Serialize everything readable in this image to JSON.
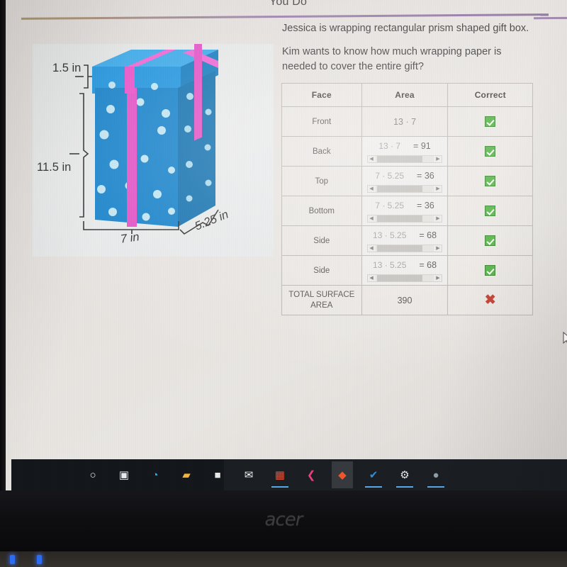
{
  "lesson": {
    "section_title": "You Do",
    "paragraph1": "Jessica is wrapping rectangular prism shaped gift box.",
    "paragraph2": "Kim wants to know how much wrapping paper is needed to cover the entire gift?"
  },
  "figure": {
    "height_label": "11.5 in",
    "lid_label": "1.5 in",
    "width_label": "7 in",
    "depth_label": "5.25 in",
    "box_color": "#1380c9",
    "lid_color": "#1f93dd",
    "ribbon_color": "#e14fc4",
    "dot_color": "#bfe4f2"
  },
  "table": {
    "headers": [
      "Face",
      "Area",
      "Correct"
    ],
    "rows": [
      {
        "face": "Front",
        "expr": "13 · 7",
        "result": "",
        "has_scrollbar": false,
        "correct": "check"
      },
      {
        "face": "Back",
        "expr": "13 · 7",
        "result": "= 91",
        "has_scrollbar": true,
        "correct": "check"
      },
      {
        "face": "Top",
        "expr": "7 · 5.25",
        "result": "= 36",
        "has_scrollbar": true,
        "correct": "check"
      },
      {
        "face": "Bottom",
        "expr": "7 · 5.25",
        "result": "= 36",
        "has_scrollbar": true,
        "correct": "check"
      },
      {
        "face": "Side",
        "expr": "13 · 5.25",
        "result": "= 68",
        "has_scrollbar": true,
        "correct": "check"
      },
      {
        "face": "Side",
        "expr": "13 · 5.25",
        "result": "= 68",
        "has_scrollbar": true,
        "correct": "check"
      }
    ],
    "total": {
      "label_line1": "TOTAL SURFACE",
      "label_line2": "AREA",
      "value": "390",
      "correct": "cross"
    },
    "marks": {
      "check_color": "#4caf3d",
      "cross_color": "#c0392b",
      "cross_glyph": "✖"
    }
  },
  "taskbar": {
    "items": [
      {
        "name": "search",
        "glyph": "○",
        "color": "#e8eaec",
        "active": false,
        "underline": false
      },
      {
        "name": "task-view",
        "glyph": "▣",
        "color": "#e8eaec",
        "active": false,
        "underline": false
      },
      {
        "name": "edge",
        "glyph": "◔",
        "color": "#2fb3e8",
        "active": false,
        "underline": false
      },
      {
        "name": "file-explorer",
        "glyph": "▰",
        "color": "#f2b63c",
        "active": false,
        "underline": false
      },
      {
        "name": "store",
        "glyph": "■",
        "color": "#e9e9e9",
        "active": false,
        "underline": false
      },
      {
        "name": "mail",
        "glyph": "✉",
        "color": "#f5f5f5",
        "active": false,
        "underline": false
      },
      {
        "name": "photos-app",
        "glyph": "▦",
        "color": "#e0533a",
        "active": false,
        "underline": true
      },
      {
        "name": "pink-app",
        "glyph": "❮",
        "color": "#e8407f",
        "active": false,
        "underline": false
      },
      {
        "name": "brave",
        "glyph": "◆",
        "color": "#f1562b",
        "active": true,
        "underline": false
      },
      {
        "name": "check-app",
        "glyph": "✔",
        "color": "#2f8fd6",
        "active": false,
        "underline": true
      },
      {
        "name": "settings",
        "glyph": "⚙",
        "color": "#e8eaec",
        "active": false,
        "underline": true
      },
      {
        "name": "disc-app",
        "glyph": "●",
        "color": "#8e9fa8",
        "active": false,
        "underline": true
      }
    ]
  },
  "laptop": {
    "brand": "acer"
  }
}
